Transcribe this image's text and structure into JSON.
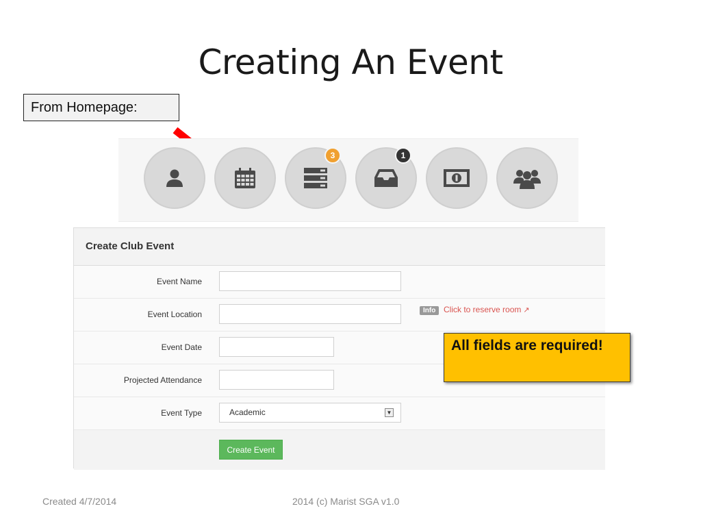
{
  "slide": {
    "title": "Creating An Event",
    "callout": "From Homepage:",
    "note": "All fields are required!",
    "footer_left": "Created 4/7/2014",
    "footer_center": "2014 (c) Marist SGA v1.0"
  },
  "icon_strip": {
    "icons": [
      {
        "name": "profile-icon",
        "badge": null
      },
      {
        "name": "calendar-icon",
        "badge": null
      },
      {
        "name": "list-icon",
        "badge": "3",
        "badge_color": "#f0a030"
      },
      {
        "name": "inbox-icon",
        "badge": "1",
        "badge_color": "#333333"
      },
      {
        "name": "money-icon",
        "badge": null
      },
      {
        "name": "group-icon",
        "badge": null
      }
    ]
  },
  "form": {
    "title": "Create Club Event",
    "fields": {
      "event_name": {
        "label": "Event Name",
        "value": ""
      },
      "event_location": {
        "label": "Event Location",
        "value": ""
      },
      "event_date": {
        "label": "Event Date",
        "value": ""
      },
      "projected_attendance": {
        "label": "Projected Attendance",
        "value": ""
      },
      "event_type": {
        "label": "Event Type",
        "value": "Academic"
      }
    },
    "info_tag": "Info",
    "reserve_link": "Click to reserve room",
    "submit_label": "Create Event"
  },
  "colors": {
    "arrow": "#ff0000",
    "submit_button": "#5cb85c",
    "note_background": "#ffc000",
    "link": "#d9534f"
  }
}
